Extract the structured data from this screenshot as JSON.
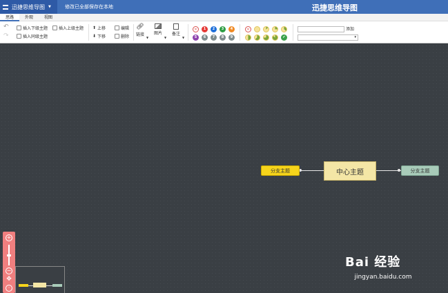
{
  "topbar": {
    "app_name": "迅捷思维导图",
    "save_status": "修改已全部保存在本地",
    "doc_title": "迅捷思维导图"
  },
  "tabs": [
    {
      "label": "思路",
      "active": true
    },
    {
      "label": "外观",
      "active": false
    },
    {
      "label": "视图",
      "active": false
    }
  ],
  "toolbar": {
    "insert_child": "插入下级主题",
    "insert_parent": "插入上级主题",
    "insert_sibling": "插入同级主题",
    "move_up": "上移",
    "move_down": "下移",
    "edit": "编辑",
    "delete": "删除",
    "link": "链接",
    "image": "图片",
    "note": "备注",
    "add": "添加",
    "priority_badges": [
      {
        "label": "✕",
        "color": "#d9534f"
      },
      {
        "label": "1",
        "color": "#e53935"
      },
      {
        "label": "2",
        "color": "#1e6fd9"
      },
      {
        "label": "3",
        "color": "#2e9e44"
      },
      {
        "label": "4",
        "color": "#f08a24"
      },
      {
        "label": "5",
        "color": "#8e44ad"
      },
      {
        "label": "6",
        "color": "#7f8c8d"
      },
      {
        "label": "7",
        "color": "#7f8c8d"
      },
      {
        "label": "8",
        "color": "#7f8c8d"
      },
      {
        "label": "9",
        "color": "#7f8c8d"
      }
    ]
  },
  "mindmap": {
    "center_topic": "中心主题",
    "left_branch": "分支主题",
    "right_branch": "分支主题"
  },
  "colors": {
    "topbar": "#3f6fb8",
    "canvas": "#3a3f44",
    "center_node": "#f4e6a6",
    "left_node": "#f6d41b",
    "right_node": "#a8cbb9",
    "zoom_panel": "#f07f7f"
  },
  "watermark": {
    "logo": "Bai 经验",
    "url": "jingyan.baidu.com"
  }
}
